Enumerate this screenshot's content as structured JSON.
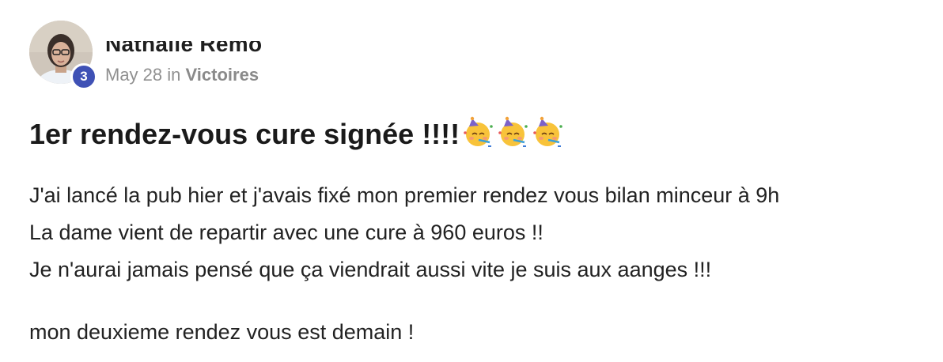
{
  "author": {
    "name": "Nathalie Remo",
    "level": "3"
  },
  "meta": {
    "date": "May 28",
    "in_word": "in",
    "category": "Victoires"
  },
  "post": {
    "title": "1er rendez-vous cure signée !!!!",
    "title_emoji": "partying-face-emoji",
    "body_lines": [
      "J'ai lancé la pub hier et j'avais fixé mon premier rendez vous bilan minceur à 9h",
      "La dame vient de repartir avec une cure à 960 euros !!",
      "Je n'aurai jamais pensé que ça viendrait aussi vite je suis aux aanges !!!",
      "mon deuxieme rendez vous est demain !"
    ]
  },
  "colors": {
    "badge": "#3f51b5",
    "meta_text": "#909090",
    "title_text": "#1a1a1a"
  }
}
